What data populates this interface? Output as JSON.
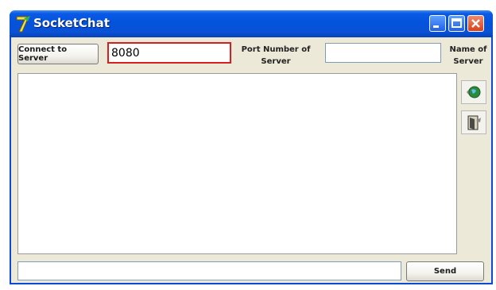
{
  "window": {
    "title": "SocketChat",
    "logo_glyph": "7"
  },
  "toolbar": {
    "connect_label": "Connect to Server",
    "port_value": "8080",
    "port_label": "Port Number of Server",
    "server_name_value": "",
    "server_name_label": "Name of Server"
  },
  "side_icons": [
    "globe-icon",
    "door-exit-icon"
  ],
  "footer": {
    "message_value": "",
    "send_label": "Send"
  },
  "colors": {
    "titlebar": "#0453dc",
    "highlight_border": "#d42020",
    "window_bg": "#ece9d8"
  }
}
